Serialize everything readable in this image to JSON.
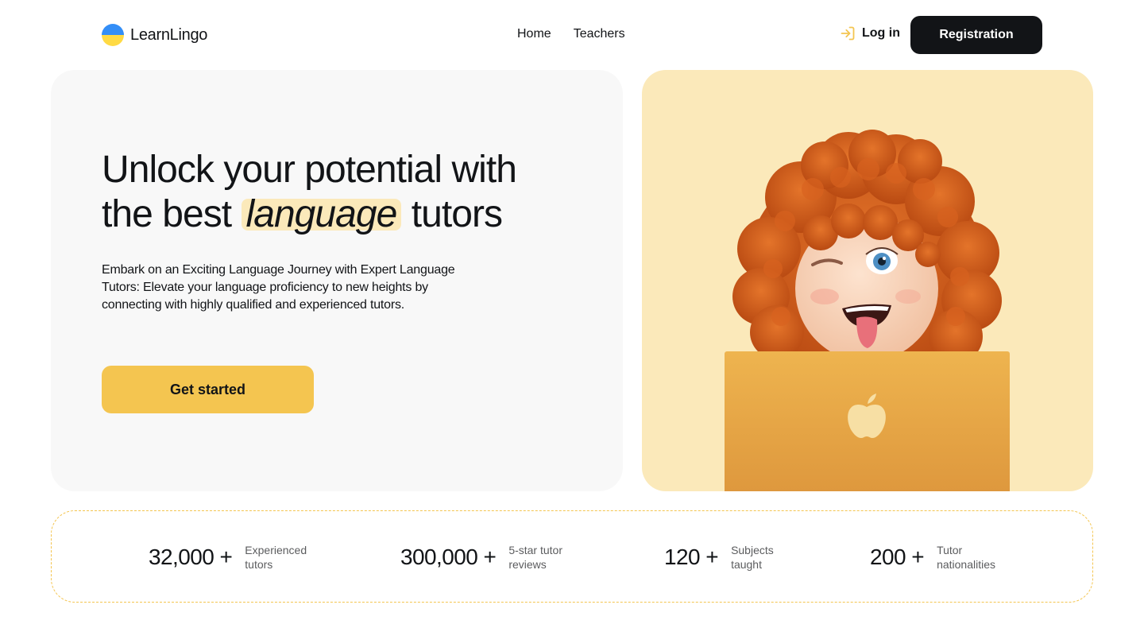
{
  "header": {
    "brand": "LearnLingo",
    "nav": [
      {
        "label": "Home"
      },
      {
        "label": "Teachers"
      }
    ],
    "login_label": "Log in",
    "register_label": "Registration"
  },
  "hero": {
    "title_before": "Unlock your potential with the best",
    "title_highlight": "language",
    "title_after": "tutors",
    "description": "Embark on an Exciting Language Journey with Expert Language Tutors: Elevate your language proficiency to new heights by connecting with highly qualified and experienced tutors.",
    "cta_label": "Get started"
  },
  "stats": [
    {
      "value": "32,000 +",
      "label": "Experienced tutors"
    },
    {
      "value": "300,000 +",
      "label": "5-star tutor reviews"
    },
    {
      "value": "120 +",
      "label": "Subjects taught"
    },
    {
      "value": "200 +",
      "label": "Tutor nationalities"
    }
  ],
  "colors": {
    "accent": "#f4c550",
    "accent_light": "#fbe9ba",
    "dark": "#121417",
    "panel": "#f8f8f8"
  }
}
